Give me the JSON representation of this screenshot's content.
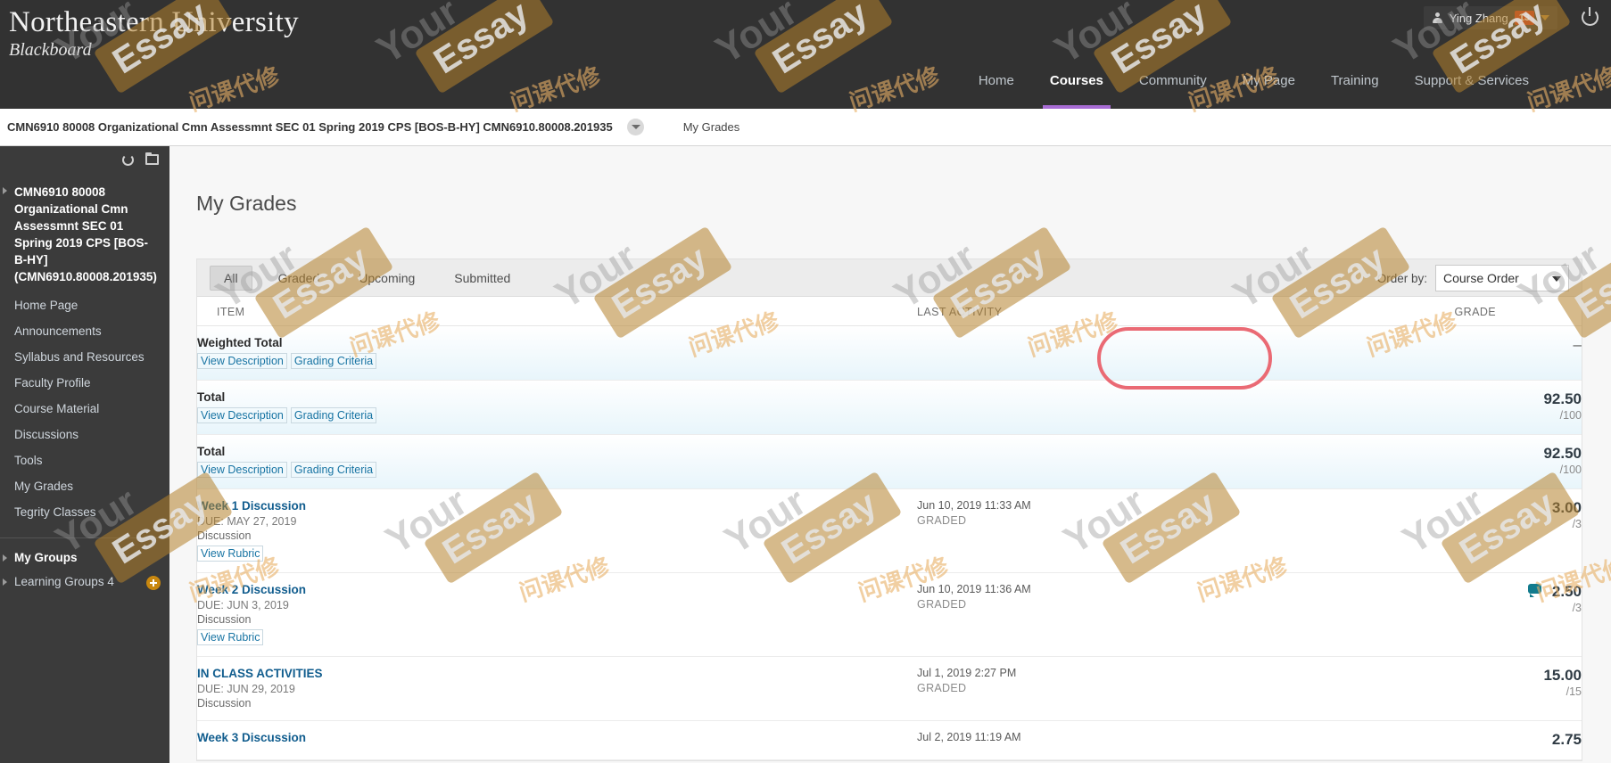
{
  "topbar": {
    "brand_line1": "Northeastern University",
    "brand_line2": "Blackboard",
    "user_name": "Ying Zhang",
    "user_badge": "13",
    "nav": [
      {
        "label": "Home",
        "active": false
      },
      {
        "label": "Courses",
        "active": true
      },
      {
        "label": "Community",
        "active": false
      },
      {
        "label": "My Page",
        "active": false
      },
      {
        "label": "Training",
        "active": false
      },
      {
        "label": "Support & Services",
        "active": false
      }
    ],
    "accent_color": "#a86cd4",
    "bar_color": "#323232",
    "badge_color": "#d13b1f"
  },
  "breadcrumb": {
    "course": "CMN6910 80008 Organizational Cmn Assessmnt SEC 01 Spring 2019 CPS [BOS-B-HY] CMN6910.80008.201935",
    "page": "My Grades"
  },
  "sidebar": {
    "course_title": "CMN6910 80008 Organizational Cmn Assessmnt SEC 01 Spring 2019 CPS [BOS-B-HY] (CMN6910.80008.201935)",
    "items": [
      {
        "label": "Home Page"
      },
      {
        "label": "Announcements"
      },
      {
        "label": "Syllabus and Resources"
      },
      {
        "label": "Faculty Profile"
      },
      {
        "label": "Course Material"
      },
      {
        "label": "Discussions"
      },
      {
        "label": "Tools"
      },
      {
        "label": "My Grades"
      },
      {
        "label": "Tegrity Classes"
      }
    ],
    "groups_title": "My Groups",
    "groups_items": [
      {
        "label": "Learning Groups 4"
      }
    ]
  },
  "main": {
    "page_title": "My Grades",
    "tabs": [
      {
        "label": "All",
        "selected": true
      },
      {
        "label": "Graded",
        "selected": false
      },
      {
        "label": "Upcoming",
        "selected": false
      },
      {
        "label": "Submitted",
        "selected": false
      }
    ],
    "orderby_label": "Order by:",
    "orderby_value": "Course Order",
    "columns": {
      "item": "ITEM",
      "activity": "LAST ACTIVITY",
      "grade": "GRADE"
    },
    "link_view_description": "View Description",
    "link_grading_criteria": "Grading Criteria",
    "link_view_rubric": "View Rubric",
    "rows": [
      {
        "title": "Weighted Total",
        "is_link": false,
        "due": "",
        "type": "",
        "links": [
          "View Description",
          "Grading Criteria"
        ],
        "activity_date": "",
        "activity_status": "",
        "grade": "–",
        "out_of": "",
        "has_comment": false,
        "total_style": true,
        "highlighted": false
      },
      {
        "title": "Total",
        "is_link": false,
        "due": "",
        "type": "",
        "links": [
          "View Description",
          "Grading Criteria"
        ],
        "activity_date": "",
        "activity_status": "",
        "grade": "92.50",
        "out_of": "/100",
        "has_comment": false,
        "total_style": true,
        "highlighted": true
      },
      {
        "title": "Total",
        "is_link": false,
        "due": "",
        "type": "",
        "links": [
          "View Description",
          "Grading Criteria"
        ],
        "activity_date": "",
        "activity_status": "",
        "grade": "92.50",
        "out_of": "/100",
        "has_comment": false,
        "total_style": true,
        "highlighted": false
      },
      {
        "title": "Week 1 Discussion",
        "is_link": true,
        "due": "DUE: MAY 27, 2019",
        "type": "Discussion",
        "links": [
          "View Rubric"
        ],
        "activity_date": "Jun 10, 2019 11:33 AM",
        "activity_status": "GRADED",
        "grade": "3.00",
        "out_of": "/3",
        "has_comment": false,
        "total_style": false,
        "highlighted": false
      },
      {
        "title": "Week 2 Discussion",
        "is_link": true,
        "due": "DUE: JUN 3, 2019",
        "type": "Discussion",
        "links": [
          "View Rubric"
        ],
        "activity_date": "Jun 10, 2019 11:36 AM",
        "activity_status": "GRADED",
        "grade": "2.50",
        "out_of": "/3",
        "has_comment": true,
        "total_style": false,
        "highlighted": false
      },
      {
        "title": "IN CLASS ACTIVITIES",
        "is_link": true,
        "due": "DUE: JUN 29, 2019",
        "type": "Discussion",
        "links": [],
        "activity_date": "Jul 1, 2019 2:27 PM",
        "activity_status": "GRADED",
        "grade": "15.00",
        "out_of": "/15",
        "has_comment": false,
        "total_style": false,
        "highlighted": false
      },
      {
        "title": "Week 3 Discussion",
        "is_link": true,
        "due": "",
        "type": "",
        "links": [],
        "activity_date": "Jul 2, 2019 11:19 AM",
        "activity_status": "",
        "grade": "2.75",
        "out_of": "",
        "has_comment": false,
        "total_style": false,
        "highlighted": false
      }
    ]
  },
  "annotation": {
    "shape": "oval",
    "color": "#ea6a74",
    "targets": "total-grade-92.50"
  },
  "watermarks": {
    "text_a": "Your",
    "text_b": "Essay",
    "text_cn": "问课代修"
  }
}
